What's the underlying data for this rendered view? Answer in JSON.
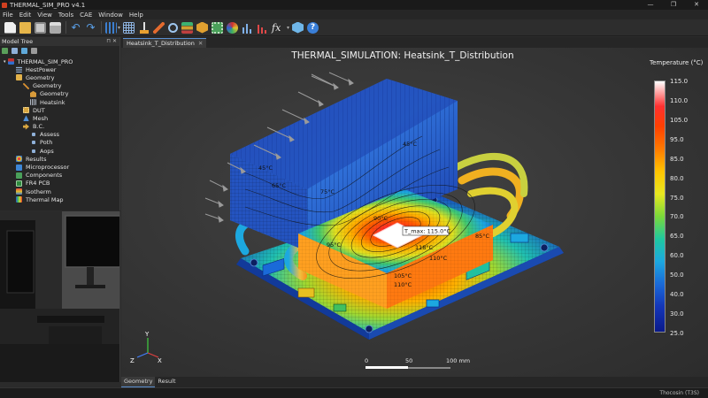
{
  "app": {
    "title": "THERMAL_SIM_PRO v4.1",
    "window_buttons": [
      "—",
      "❐",
      "✕"
    ]
  },
  "menu": [
    "File",
    "Edit",
    "View",
    "Tools",
    "CAE",
    "Window",
    "Help"
  ],
  "toolbar": {
    "icons": [
      "new-file-icon",
      "open-folder-icon",
      "save-icon",
      "print-icon",
      "undo-icon",
      "redo-icon",
      "mesh-icon",
      "grid-icon",
      "probe-icon",
      "sweep-icon",
      "zoom-icon",
      "layers-icon",
      "cube-icon",
      "chip-icon",
      "contour-icon",
      "histogram-icon",
      "plot-icon",
      "function-icon",
      "box-3d-icon",
      "help-icon"
    ],
    "fx_label": "fx",
    "help_label": "?"
  },
  "model_tree": {
    "title": "Model Tree",
    "header_buttons": "⊓ ✕",
    "items": [
      {
        "label": "THERMAL_SIM_PRO",
        "icon": "root-icon",
        "level": 0
      },
      {
        "label": "HestPower",
        "icon": "table-icon",
        "level": 1
      },
      {
        "label": "Geometry",
        "icon": "folder-icon",
        "level": 1
      },
      {
        "label": "Geometry",
        "icon": "tool-icon",
        "level": 2
      },
      {
        "label": "Geometry",
        "icon": "geometry-icon",
        "level": 3
      },
      {
        "label": "Heatsink",
        "icon": "heatsink-icon",
        "level": 3
      },
      {
        "label": "DUT",
        "icon": "chip-icon",
        "level": 2
      },
      {
        "label": "Mesh",
        "icon": "mesh-icon",
        "level": 2
      },
      {
        "label": "B.C.",
        "icon": "bc-icon",
        "level": 2
      },
      {
        "label": "Assess",
        "icon": "bullet-icon",
        "level": 3
      },
      {
        "label": "Poth",
        "icon": "bullet-icon",
        "level": 3
      },
      {
        "label": "Aops",
        "icon": "bullet-icon",
        "level": 3
      },
      {
        "label": "Results",
        "icon": "results-icon",
        "level": 1
      },
      {
        "label": "Microprocessor",
        "icon": "cpu-icon",
        "level": 1
      },
      {
        "label": "Components",
        "icon": "components-icon",
        "level": 1
      },
      {
        "label": "FR4 PCB",
        "icon": "pcb-icon",
        "level": 1
      },
      {
        "label": "Isotherm",
        "icon": "isotherm-icon",
        "level": 1
      },
      {
        "label": "Thermal Map",
        "icon": "thermal-map-icon",
        "level": 1
      }
    ]
  },
  "viewport": {
    "tab_label": "Heatsink_T_Distribution",
    "tab_close": "✕",
    "title": "THERMAL_SIMULATION: Heatsink_T_Distribution",
    "tmax_label": "T_max: 115.0°C",
    "contour_labels": [
      "45°C",
      "65°C",
      "75°C",
      "90°C",
      "85°C",
      "95°C",
      "118°C",
      "110°C",
      "105°C",
      "110°C",
      "45°C"
    ],
    "scale": {
      "ticks": [
        "0",
        "50",
        "100 mm"
      ]
    },
    "axes": {
      "x": "X",
      "y": "Y",
      "z": "Z"
    }
  },
  "legend": {
    "title": "Temperature (°C)",
    "min": 25.0,
    "max": 115.0,
    "ticks": [
      "115.0",
      "110.0",
      "105.0",
      "95.0",
      "85.0",
      "80.0",
      "75.0",
      "70.0",
      "65.0",
      "60.0",
      "50.0",
      "40.0",
      "30.0",
      "25.0"
    ]
  },
  "bottom_tabs": [
    "Geometry",
    "Result"
  ],
  "status": {
    "user": "Thocosin (T3S)"
  }
}
